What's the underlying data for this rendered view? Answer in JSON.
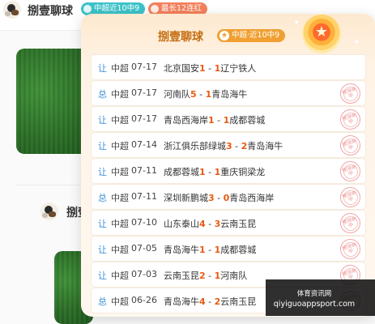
{
  "header": {
    "author": "捌壹聊球",
    "tags": [
      {
        "label": "中超近10中9",
        "color": "#3cc3c9"
      },
      {
        "label": "最长12连红",
        "color": "#f4805b"
      }
    ]
  },
  "feed": {
    "second_author": "捌壹",
    "bottom_text": "…"
  },
  "popup": {
    "title": "捌壹聊球",
    "badge": "中超·近10中9",
    "badge_icon": "★",
    "hit_stamp": "预测命中",
    "records": [
      {
        "type": "让",
        "type_color": "#3a8fd8",
        "league": "中超",
        "date": "07-17",
        "home": "北京国安",
        "home_score": "1",
        "sep": "-",
        "away_score": "1",
        "away": "辽宁铁人",
        "hit": false
      },
      {
        "type": "总",
        "type_color": "#3a8fd8",
        "league": "中超",
        "date": "07-17",
        "home": "河南队",
        "home_score": "5",
        "sep": "-",
        "away_score": "1",
        "away": "青岛海牛",
        "hit": true
      },
      {
        "type": "让",
        "type_color": "#3a8fd8",
        "league": "中超",
        "date": "07-17",
        "home": "青岛西海岸",
        "home_score": "1",
        "sep": "-",
        "away_score": "1",
        "away": "成都蓉城",
        "hit": true
      },
      {
        "type": "让",
        "type_color": "#3a8fd8",
        "league": "中超",
        "date": "07-14",
        "home": "浙江俱乐部绿城",
        "home_score": "3",
        "sep": "-",
        "away_score": "2",
        "away": "青岛海牛",
        "hit": true
      },
      {
        "type": "让",
        "type_color": "#3a8fd8",
        "league": "中超",
        "date": "07-11",
        "home": "成都蓉城",
        "home_score": "1",
        "sep": "-",
        "away_score": "1",
        "away": "重庆铜梁龙",
        "hit": true
      },
      {
        "type": "总",
        "type_color": "#3a8fd8",
        "league": "中超",
        "date": "07-11",
        "home": "深圳新鹏城",
        "home_score": "3",
        "sep": "-",
        "away_score": "0",
        "away": "青岛西海岸",
        "hit": true
      },
      {
        "type": "让",
        "type_color": "#3a8fd8",
        "league": "中超",
        "date": "07-10",
        "home": "山东泰山",
        "home_score": "4",
        "sep": "-",
        "away_score": "3",
        "away": "云南玉昆",
        "hit": true
      },
      {
        "type": "让",
        "type_color": "#3a8fd8",
        "league": "中超",
        "date": "07-05",
        "home": "青岛海牛",
        "home_score": "1",
        "sep": "-",
        "away_score": "1",
        "away": "成都蓉城",
        "hit": true
      },
      {
        "type": "让",
        "type_color": "#3a8fd8",
        "league": "中超",
        "date": "07-03",
        "home": "云南玉昆",
        "home_score": "2",
        "sep": "-",
        "away_score": "1",
        "away": "河南队",
        "hit": true
      },
      {
        "type": "总",
        "type_color": "#3a8fd8",
        "league": "中超",
        "date": "06-26",
        "home": "青岛海牛",
        "home_score": "4",
        "sep": "-",
        "away_score": "2",
        "away": "云南玉昆",
        "hit": true
      }
    ]
  },
  "watermark": {
    "line1": "体育资讯网",
    "line2": "qiyiguoappsport.com"
  }
}
